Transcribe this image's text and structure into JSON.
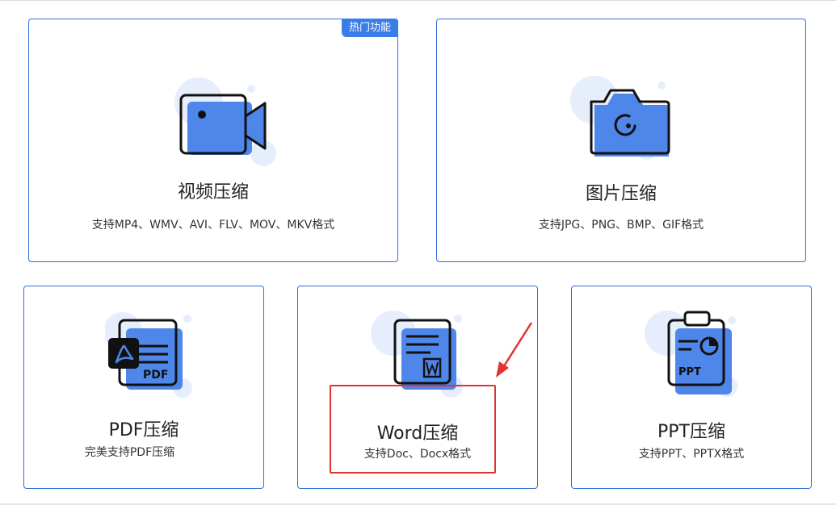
{
  "cards": {
    "video": {
      "title": "视频压缩",
      "desc": "支持MP4、WMV、AVI、FLV、MOV、MKV格式",
      "badge": "热门功能",
      "icon": "video-camera-icon"
    },
    "image": {
      "title": "图片压缩",
      "desc": "支持JPG、PNG、BMP、GIF格式",
      "icon": "camera-icon"
    },
    "pdf": {
      "title": "PDF压缩",
      "desc": "完美支持PDF压缩",
      "icon": "pdf-document-icon",
      "icon_text": "PDF"
    },
    "word": {
      "title": "Word压缩",
      "desc": "支持Doc、Docx格式",
      "icon": "word-document-icon"
    },
    "ppt": {
      "title": "PPT压缩",
      "desc": "支持PPT、PPTX格式",
      "icon": "ppt-clipboard-icon",
      "icon_text": "PPT"
    }
  },
  "colors": {
    "accent": "#3b7de8",
    "icon_fill": "#4f86ea",
    "bubble": "#e6eefc",
    "annotation": "#e23232"
  }
}
